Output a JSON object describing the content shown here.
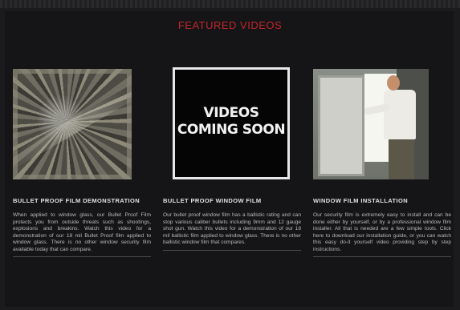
{
  "section_title": "FEATURED VIDEOS",
  "cards": [
    {
      "title": "BULLET PROOF FILM DEMONSTRATION",
      "description": "When applied to window glass, our Bullet Proof Film protects you from outside threats such as shootings, explosions and breakins. Watch this video for a demonstration of our 18 mil Bullet Proof film applied to window glass. There is no other window security film available today that can compare."
    },
    {
      "title": "BULLET PROOF WINDOW FILM",
      "thumbnail_text_line1": "VIDEOS",
      "thumbnail_text_line2": "COMING SOON",
      "description": "Our bullet proof window film has a ballistic rating and can stop various caliber bullets including 9mm and 12 gauge shot gun. Watch this video for a demonstration of our 18 mil ballistic film applied to window glass. There is no other ballistic window film that compares."
    },
    {
      "title": "WINDOW FILM INSTALLATION",
      "description": "Our security film is extremely easy to install and can be done either by yourself, or by a professional window film installer. All that is needed are a few simple tools. Click here to download our installation guide, or you can watch this easy do-it yourself video providing step by step instructions."
    }
  ],
  "colors": {
    "accent": "#c0262b",
    "background": "#151517"
  }
}
